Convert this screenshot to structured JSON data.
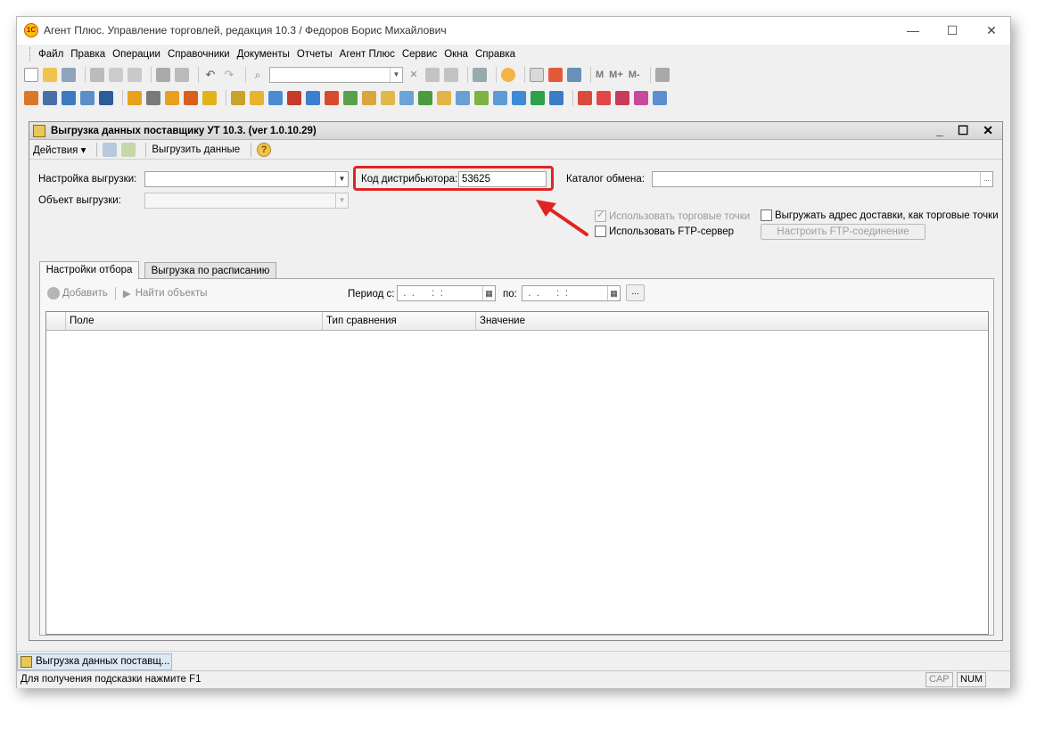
{
  "window": {
    "title": "Агент Плюс. Управление торговлей, редакция 10.3 / Федоров Борис Михайлович",
    "minimize": "—",
    "maximize": "☐",
    "close": "✕"
  },
  "menu": [
    "Файл",
    "Правка",
    "Операции",
    "Справочники",
    "Документы",
    "Отчеты",
    "Агент Плюс",
    "Сервис",
    "Окна",
    "Справка"
  ],
  "toolbar": {
    "mem_labels": [
      "M",
      "M+",
      "M-"
    ]
  },
  "form": {
    "title": "Выгрузка данных поставщику УТ 10.3. (ver 1.0.10.29)",
    "controls": "_ ☐ ✕",
    "toolbar": {
      "actions_label": "Действия ▾",
      "export_label": "Выгрузить данные",
      "help": "?"
    },
    "fields": {
      "export_setting_label": "Настройка выгрузки:",
      "export_setting_value": "",
      "export_object_label": "Объект выгрузки:",
      "export_object_value": "",
      "distributor_code_label": "Код дистрибьютора:",
      "distributor_code_value": "53625",
      "exchange_catalog_label": "Каталог обмена:",
      "exchange_catalog_value": "",
      "browse": "..."
    },
    "options": {
      "use_trade_points": "Использовать торговые точки",
      "use_trade_points_checked": true,
      "export_delivery_address": "Выгружать адрес доставки, как торговые точки",
      "export_delivery_address_checked": false,
      "use_ftp": "Использовать FTP-сервер",
      "use_ftp_checked": false,
      "configure_ftp": "Настроить FTP-соединение"
    },
    "tabs": [
      {
        "label": "Настройки отбора",
        "active": true
      },
      {
        "label": "Выгрузка по расписанию",
        "active": false
      }
    ],
    "filter": {
      "add_label": "Добавить",
      "find_label": "Найти объекты",
      "period_from_label": "Период с:",
      "period_from_value": " .  .      :  :",
      "period_to_label": "по:",
      "period_to_value": " .  .      :  :",
      "period_button": "..."
    },
    "grid": {
      "columns": [
        "Поле",
        "Тип сравнения",
        "Значение"
      ],
      "rows": []
    }
  },
  "taskbar": {
    "item": "Выгрузка данных поставщ..."
  },
  "status": {
    "hint": "Для получения подсказки нажмите F1",
    "cap": "CAP",
    "num": "NUM"
  },
  "colors": {
    "highlight": "#e02424",
    "arrow": "#e02424"
  }
}
